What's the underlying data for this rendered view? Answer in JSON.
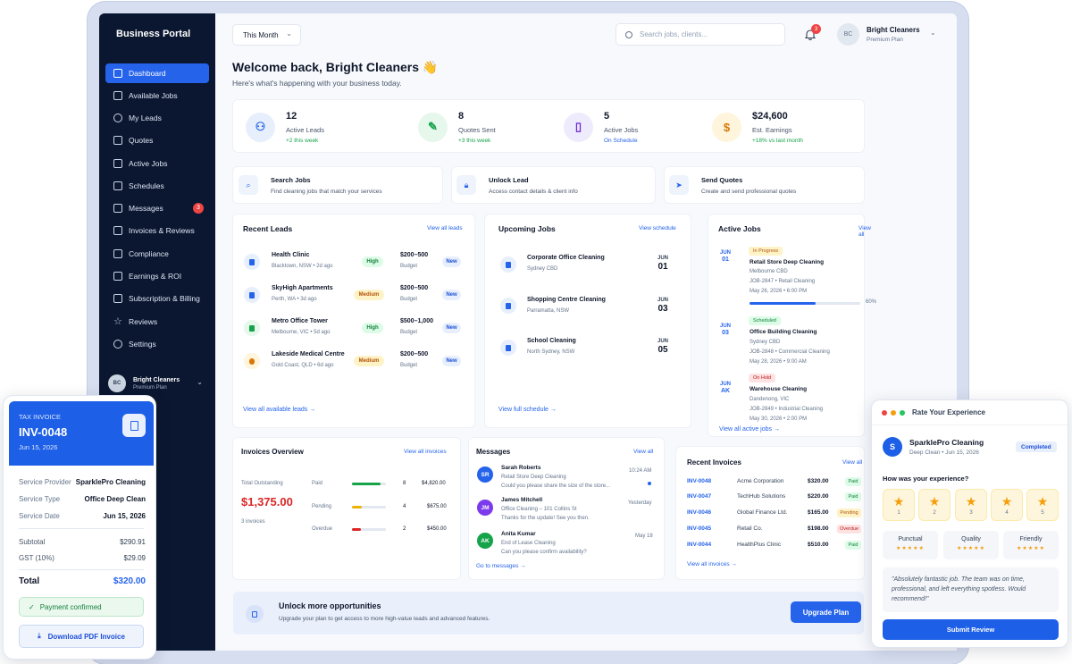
{
  "sidebar": {
    "brand": "Business Portal",
    "items": [
      {
        "label": "Dashboard"
      },
      {
        "label": "Available Jobs"
      },
      {
        "label": "My Leads"
      },
      {
        "label": "Quotes"
      },
      {
        "label": "Active Jobs"
      },
      {
        "label": "Schedules"
      },
      {
        "label": "Messages",
        "badge": "3"
      },
      {
        "label": "Invoices & Reviews"
      },
      {
        "label": "Compliance"
      },
      {
        "label": "Earnings & ROI"
      },
      {
        "label": "Subscription & Billing"
      },
      {
        "label": "Reviews"
      },
      {
        "label": "Settings"
      }
    ],
    "user": {
      "initials": "BC",
      "name": "Bright Cleaners",
      "plan": "Premium Plan"
    }
  },
  "topbar": {
    "period": "This Month",
    "search_placeholder": "Search jobs, clients...",
    "notif_count": "3",
    "avatar": "BC",
    "user_name": "Bright Cleaners",
    "user_plan": "Premium Plan"
  },
  "welcome": {
    "title": "Welcome back, Bright Cleaners 👋",
    "subtitle": "Here's what's happening with your business today."
  },
  "stats": [
    {
      "value": "12",
      "label": "Active Leads",
      "sub": "+2 this week",
      "icon": "users-icon"
    },
    {
      "value": "8",
      "label": "Quotes Sent",
      "sub": "+3 this week",
      "icon": "edit-icon"
    },
    {
      "value": "5",
      "label": "Active Jobs",
      "sub": "On Schedule",
      "icon": "file-icon"
    },
    {
      "value": "$24,600",
      "label": "Est. Earnings",
      "sub": "+18% vs last month",
      "icon": "dollar-icon"
    }
  ],
  "quick_actions": [
    {
      "title": "Search Jobs",
      "desc": "Find cleaning jobs that match your services"
    },
    {
      "title": "Unlock Lead",
      "desc": "Access contact details & client info"
    },
    {
      "title": "Send Quotes",
      "desc": "Create and send professional quotes"
    }
  ],
  "recent_leads": {
    "title": "Recent Leads",
    "link": "View all leads",
    "footer": "View all available leads →",
    "rows": [
      {
        "name": "Health Clinic",
        "meta": "Blacktown, NSW • 2d ago",
        "priority": "High",
        "budget": "$200–500",
        "budget_label": "Budget",
        "status": "New"
      },
      {
        "name": "SkyHigh Apartments",
        "meta": "Perth, WA • 3d ago",
        "priority": "Medium",
        "budget": "$200–500",
        "budget_label": "Budget",
        "status": "New"
      },
      {
        "name": "Metro Office Tower",
        "meta": "Melbourne, VIC • 5d ago",
        "priority": "High",
        "budget": "$500–1,000",
        "budget_label": "Budget",
        "status": "New"
      },
      {
        "name": "Lakeside Medical Centre",
        "meta": "Gold Coast, QLD • 6d ago",
        "priority": "Medium",
        "budget": "$200–500",
        "budget_label": "Budget",
        "status": "New"
      }
    ]
  },
  "upcoming_jobs": {
    "title": "Upcoming Jobs",
    "link": "View schedule",
    "footer": "View full schedule →",
    "rows": [
      {
        "name": "Corporate Office Cleaning",
        "place": "Sydney CBD",
        "month": "JUN",
        "day": "01"
      },
      {
        "name": "Shopping Centre Cleaning",
        "place": "Parramatta, NSW",
        "month": "JUN",
        "day": "03"
      },
      {
        "name": "School Cleaning",
        "place": "North Sydney, NSW",
        "month": "JUN",
        "day": "05"
      }
    ]
  },
  "active_jobs": {
    "title": "Active Jobs",
    "link": "View all",
    "footer": "View all active jobs →",
    "rows": [
      {
        "status": "In Progress",
        "name": "Retail Store Deep Cleaning",
        "place": "Melbourne CBD",
        "ref": "JOB-2847 • Retail Cleaning",
        "when": "May 26, 2026 • 6:00 PM",
        "month": "JUN",
        "day": "01",
        "progress": 0.6,
        "progress_label": "60%"
      },
      {
        "status": "Scheduled",
        "name": "Office Building Cleaning",
        "place": "Sydney CBD",
        "ref": "JOB-2848 • Commercial Cleaning",
        "when": "May 28, 2026 • 9:00 AM",
        "month": "JUN",
        "day": "03"
      },
      {
        "status": "On Hold",
        "name": "Warehouse Cleaning",
        "place": "Dandenong, VIC",
        "ref": "JOB-2849 • Industrial Cleaning",
        "when": "May 30, 2026 • 2:00 PM",
        "month": "JUN",
        "day": "AK"
      }
    ]
  },
  "invoices_overview": {
    "title": "Invoices Overview",
    "link": "View all invoices",
    "outstanding_label": "Total Outstanding",
    "outstanding": "$1,375.00",
    "count": "3 invoices",
    "rows": [
      {
        "label": "Paid",
        "count": "8",
        "amount": "$4,820.00",
        "fill": 0.85,
        "color": "#16a34a"
      },
      {
        "label": "Pending",
        "count": "4",
        "amount": "$675.00",
        "fill": 0.3,
        "color": "#eab308"
      },
      {
        "label": "Overdue",
        "count": "2",
        "amount": "$450.00",
        "fill": 0.25,
        "color": "#dc2626"
      }
    ]
  },
  "messages": {
    "title": "Messages",
    "link": "View all",
    "footer": "Go to messages →",
    "rows": [
      {
        "initials": "SR",
        "name": "Sarah Roberts",
        "subject": "Retail Store Deep Cleaning",
        "preview": "Could you please share the size of the store...",
        "time": "10:24 AM",
        "color": "#2563eb"
      },
      {
        "initials": "JM",
        "name": "James Mitchell",
        "subject": "Office Cleaning – 101 Collins St",
        "preview": "Thanks for the update! See you then.",
        "time": "Yesterday",
        "color": "#7c3aed"
      },
      {
        "initials": "AK",
        "name": "Anita Kumar",
        "subject": "End of Lease Cleaning",
        "preview": "Can you please confirm availability?",
        "time": "May 18",
        "color": "#16a34a"
      }
    ]
  },
  "recent_invoices": {
    "title": "Recent Invoices",
    "link": "View all",
    "footer": "View all invoices →",
    "rows": [
      {
        "id": "INV-0048",
        "client": "Acme Corporation",
        "amount": "$320.00",
        "status": "Paid"
      },
      {
        "id": "INV-0047",
        "client": "TechHub Solutions",
        "amount": "$220.00",
        "status": "Paid"
      },
      {
        "id": "INV-0046",
        "client": "Global Finance Ltd.",
        "amount": "$165.00",
        "status": "Pending"
      },
      {
        "id": "INV-0045",
        "client": "Retail Co.",
        "amount": "$198.00",
        "status": "Overdue"
      },
      {
        "id": "INV-0044",
        "client": "HealthPlus Clinic",
        "amount": "$510.00",
        "status": "Paid"
      }
    ]
  },
  "upgrade": {
    "title": "Unlock more opportunities",
    "desc": "Upgrade your plan to get access to more high-value leads and advanced features.",
    "button": "Upgrade Plan"
  },
  "tax_invoice": {
    "label": "TAX INVOICE",
    "number": "INV-0048",
    "date": "Jun 15, 2026",
    "rows": [
      {
        "k": "Service Provider",
        "v": "SparklePro Cleaning"
      },
      {
        "k": "Service Type",
        "v": "Office Deep Clean"
      },
      {
        "k": "Service Date",
        "v": "Jun 15, 2026"
      }
    ],
    "subtotal_label": "Subtotal",
    "subtotal": "$290.91",
    "gst_label": "GST (10%)",
    "gst": "$29.09",
    "total_label": "Total",
    "total": "$320.00",
    "confirmed": "Payment confirmed",
    "download": "Download PDF Invoice"
  },
  "rating": {
    "window_title": "Rate Your Experience",
    "company_initial": "S",
    "company": "SparklePro Cleaning",
    "service": "Deep Clean • Jun 15, 2026",
    "status": "Completed",
    "question": "How was your experience?",
    "stars": [
      "1",
      "2",
      "3",
      "4",
      "5"
    ],
    "criteria": [
      "Punctual",
      "Quality",
      "Friendly"
    ],
    "criteria_stars": "★★★★★",
    "comment": "\"Absolutely fantastic job. The team was on time, professional, and left everything spotless. Would recommend!\"",
    "submit": "Submit Review"
  }
}
